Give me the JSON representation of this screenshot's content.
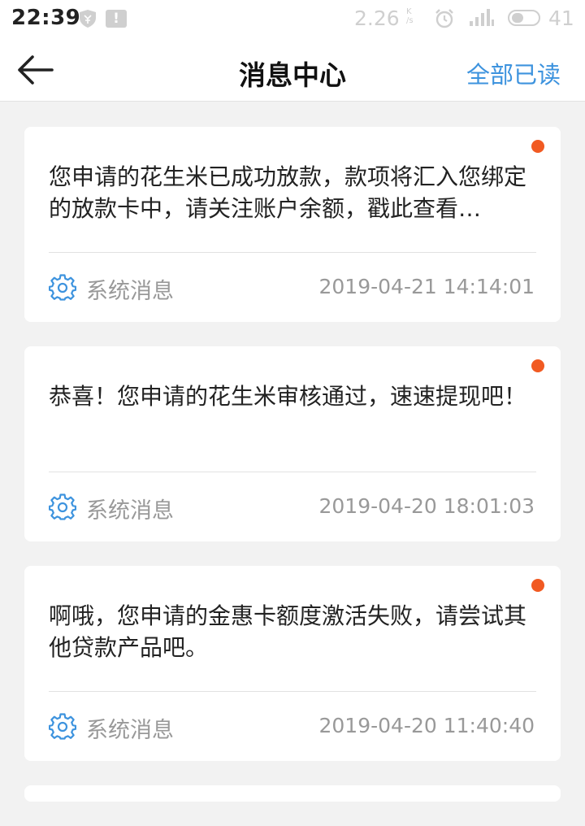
{
  "status_bar": {
    "time": "22:39",
    "network_speed": "2.26",
    "speed_unit_top": "K",
    "speed_unit_bottom": "/s",
    "alert_glyph": "!",
    "battery": "41"
  },
  "nav": {
    "title": "消息中心",
    "action": "全部已读"
  },
  "colors": {
    "accent": "#3d93de",
    "unread": "#f15a22",
    "muted_text": "#999999"
  },
  "messages": [
    {
      "text": "您申请的花生米已成功放款，款项将汇入您绑定的放款卡中，请关注账户余额，戳此查看…",
      "type": "系统消息",
      "time": "2019-04-21 14:14:01",
      "icon": "gear-icon"
    },
    {
      "text": "恭喜！您申请的花生米审核通过，速速提现吧！",
      "type": "系统消息",
      "time": "2019-04-20 18:01:03",
      "icon": "gear-icon"
    },
    {
      "text": "啊哦，您申请的金惠卡额度激活失败，请尝试其他贷款产品吧。",
      "type": "系统消息",
      "time": "2019-04-20 11:40:40",
      "icon": "gear-icon"
    }
  ]
}
